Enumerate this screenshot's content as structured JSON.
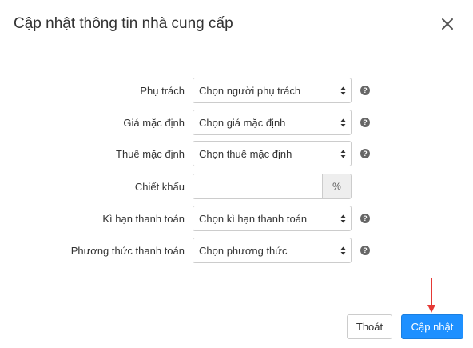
{
  "dialog": {
    "title": "Cập nhật thông tin nhà cung cấp",
    "close_icon": "close-icon"
  },
  "form": {
    "fields": [
      {
        "label": "Phụ trách",
        "type": "select",
        "value": "Chọn người phụ trách",
        "help": true
      },
      {
        "label": "Giá mặc định",
        "type": "select",
        "value": "Chọn giá mặc định",
        "help": true
      },
      {
        "label": "Thuế mặc định",
        "type": "select",
        "value": "Chọn thuế mặc định",
        "help": true
      },
      {
        "label": "Chiết khấu",
        "type": "input",
        "value": "",
        "addon": "%",
        "help": false
      },
      {
        "label": "Kì hạn thanh toán",
        "type": "select",
        "value": "Chọn kì hạn thanh toán",
        "help": true
      },
      {
        "label": "Phương thức thanh toán",
        "type": "select",
        "value": "Chọn phương thức",
        "help": true
      }
    ],
    "help_glyph": "?"
  },
  "footer": {
    "cancel_label": "Thoát",
    "submit_label": "Cập nhật"
  },
  "colors": {
    "primary": "#1e90ff",
    "annotation_arrow": "#e53935",
    "help_icon": "#666666"
  }
}
